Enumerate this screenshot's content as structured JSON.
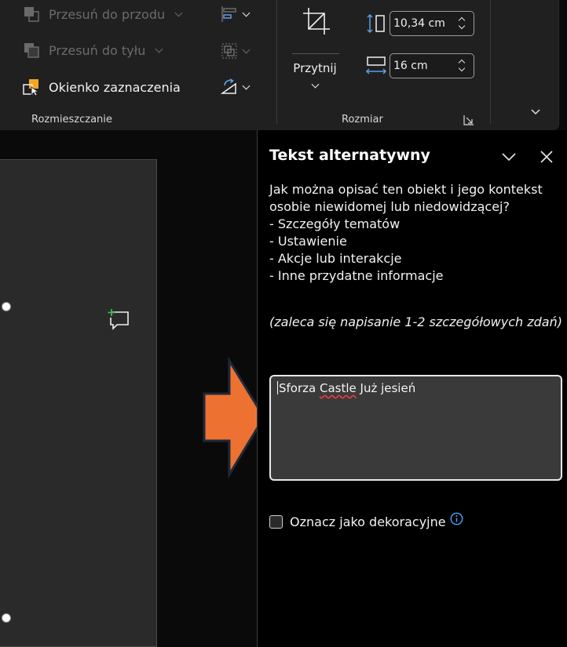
{
  "ribbon": {
    "arrange": {
      "bring_forward": "Przesuń do przodu",
      "send_backward": "Przesuń do tyłu",
      "selection_pane": "Okienko zaznaczenia",
      "group_label": "Rozmieszczanie"
    },
    "size": {
      "crop_label": "Przytnij",
      "height_value": "10,34 cm",
      "width_value": "16 cm",
      "group_label": "Rozmiar"
    }
  },
  "alt_text_pane": {
    "title": "Tekst alternatywny",
    "question": "Jak można opisać ten obiekt i jego kontekst osobie niewidomej lub niedowidzącej?",
    "bullets": [
      "- Szczegóły tematów",
      "- Ustawienie",
      "- Akcje lub interakcje",
      "- Inne przydatne informacje"
    ],
    "hint": "(zaleca się napisanie 1-2 szczegółowych zdań)",
    "alt_text": {
      "part1": "Sforza ",
      "misspelled": "Castle",
      "part2": " Już jesień"
    },
    "decorative_label": "Oznacz jako dekoracyjne"
  },
  "colors": {
    "ribbon_bg": "#202020",
    "pane_bg": "#000000",
    "arrow_fill": "#ed7232",
    "info_blue": "#4aa3ff",
    "comment_green": "#3fb950"
  },
  "icons": [
    "bring-forward-icon",
    "send-backward-icon",
    "selection-pane-icon",
    "align-icon",
    "group-icon",
    "rotate-icon",
    "crop-icon",
    "height-icon",
    "width-icon",
    "dialog-launcher-icon",
    "collapse-ribbon-icon",
    "collapse-pane-icon",
    "close-icon",
    "new-comment-icon",
    "info-icon"
  ]
}
